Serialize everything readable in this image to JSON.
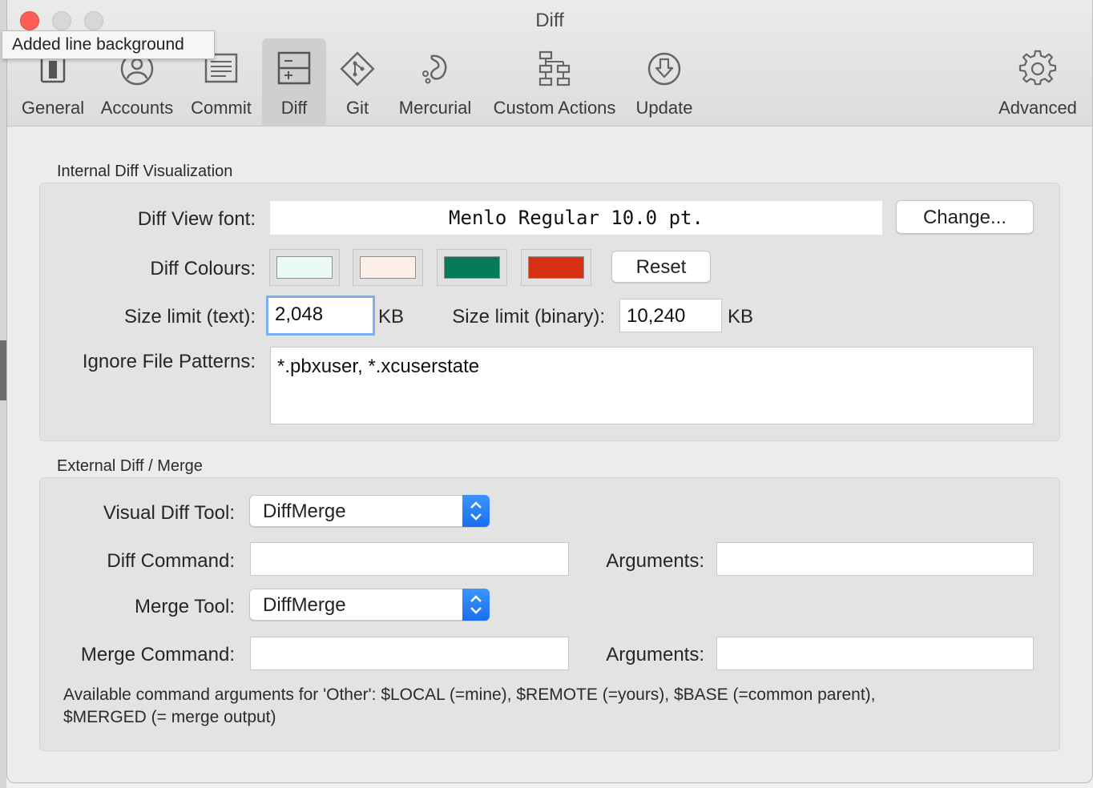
{
  "window": {
    "title": "Diff"
  },
  "tooltip": "Added line background",
  "toolbar": {
    "tabs": [
      {
        "label": "General",
        "icon": "switch-icon"
      },
      {
        "label": "Accounts",
        "icon": "person-icon"
      },
      {
        "label": "Commit",
        "icon": "document-icon"
      },
      {
        "label": "Diff",
        "icon": "diff-icon",
        "active": true
      },
      {
        "label": "Git",
        "icon": "git-icon"
      },
      {
        "label": "Mercurial",
        "icon": "mercurial-icon"
      },
      {
        "label": "Custom Actions",
        "icon": "custom-actions-icon"
      },
      {
        "label": "Update",
        "icon": "update-icon"
      },
      {
        "label": "Advanced",
        "icon": "gear-icon"
      }
    ]
  },
  "internal": {
    "section_title": "Internal Diff Visualization",
    "font_label": "Diff View font:",
    "font_value": "Menlo Regular 10.0 pt.",
    "change_button": "Change...",
    "colours_label": "Diff Colours:",
    "colours": [
      "#e9fbf3",
      "#fdeeea",
      "#077a5b",
      "#d63112"
    ],
    "reset_button": "Reset",
    "size_text_label": "Size limit (text):",
    "size_text_value": "2,048",
    "size_text_unit": "KB",
    "size_binary_label": "Size limit (binary):",
    "size_binary_value": "10,240",
    "size_binary_unit": "KB",
    "ignore_label": "Ignore File Patterns:",
    "ignore_value": "*.pbxuser, *.xcuserstate"
  },
  "external": {
    "section_title": "External Diff / Merge",
    "visual_tool_label": "Visual Diff Tool:",
    "visual_tool_value": "DiffMerge",
    "diff_command_label": "Diff Command:",
    "diff_command_value": "",
    "diff_args_label": "Arguments:",
    "diff_args_value": "",
    "merge_tool_label": "Merge Tool:",
    "merge_tool_value": "DiffMerge",
    "merge_command_label": "Merge Command:",
    "merge_command_value": "",
    "merge_args_label": "Arguments:",
    "merge_args_value": "",
    "help_line1": "Available command arguments for 'Other': $LOCAL (=mine), $REMOTE (=yours), $BASE (=common parent),",
    "help_line2": "$MERGED (= merge output)"
  },
  "colors": {
    "accent": "#1a6ff0",
    "close": "#fd5f57",
    "focus_ring": "#7fadf1"
  }
}
